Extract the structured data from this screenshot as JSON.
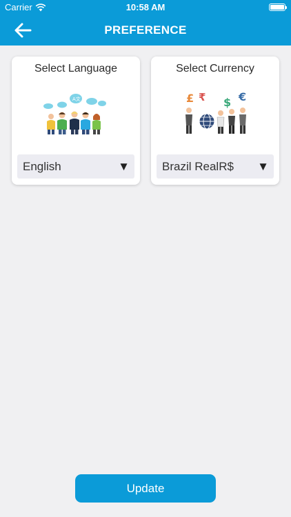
{
  "status_bar": {
    "carrier": "Carrier",
    "time": "10:58 AM"
  },
  "navbar": {
    "title": "PREFERENCE",
    "back_icon": "arrow-left-icon"
  },
  "language_card": {
    "title": "Select Language",
    "illustration": "people-speaking-languages-illustration",
    "selected": "English"
  },
  "currency_card": {
    "title": "Select Currency",
    "illustration": "people-holding-currency-symbols-illustration",
    "selected": "Brazil RealR$"
  },
  "update_label": "Update",
  "colors": {
    "accent": "#0b9bd8",
    "background": "#f0f0f2",
    "select_bg": "#ececf2"
  }
}
